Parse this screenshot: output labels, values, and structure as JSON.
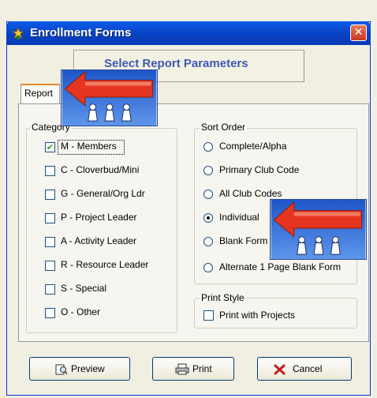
{
  "window": {
    "title": "Enrollment Forms",
    "close_glyph": "✕",
    "icon": "app-icon"
  },
  "header": {
    "title": "Select Report Parameters"
  },
  "tabs": [
    {
      "label": "Report",
      "selected": true
    }
  ],
  "category": {
    "legend": "Category",
    "items": [
      {
        "label": "M - Members",
        "checked": true
      },
      {
        "label": "C - Cloverbud/Mini",
        "checked": false
      },
      {
        "label": "G - General/Org Ldr",
        "checked": false
      },
      {
        "label": "P - Project Leader",
        "checked": false
      },
      {
        "label": "A - Activity Leader",
        "checked": false
      },
      {
        "label": "R - Resource Leader",
        "checked": false
      },
      {
        "label": "S - Special",
        "checked": false
      },
      {
        "label": "O - Other",
        "checked": false
      }
    ]
  },
  "sort_order": {
    "legend": "Sort Order",
    "selected": "Individual",
    "options": [
      {
        "label": "Complete/Alpha"
      },
      {
        "label": "Primary Club Code"
      },
      {
        "label": "All Club Codes"
      },
      {
        "label": "Individual"
      },
      {
        "label": "Blank Form"
      },
      {
        "label": "Alternate 1 Page Blank Form"
      }
    ]
  },
  "print_style": {
    "legend": "Print Style",
    "label": "Print with Projects",
    "checked": false
  },
  "buttons": {
    "preview": "Preview",
    "print": "Print",
    "cancel": "Cancel"
  },
  "overlays": {
    "arrow_icon": "red-arrow-left-icon"
  },
  "colors": {
    "title_bar": "#0842c4",
    "header_text": "#3e59b6",
    "tab_accent": "#e68b2c",
    "arrow_red": "#e53520",
    "cancel_x": "#c41e1e"
  }
}
